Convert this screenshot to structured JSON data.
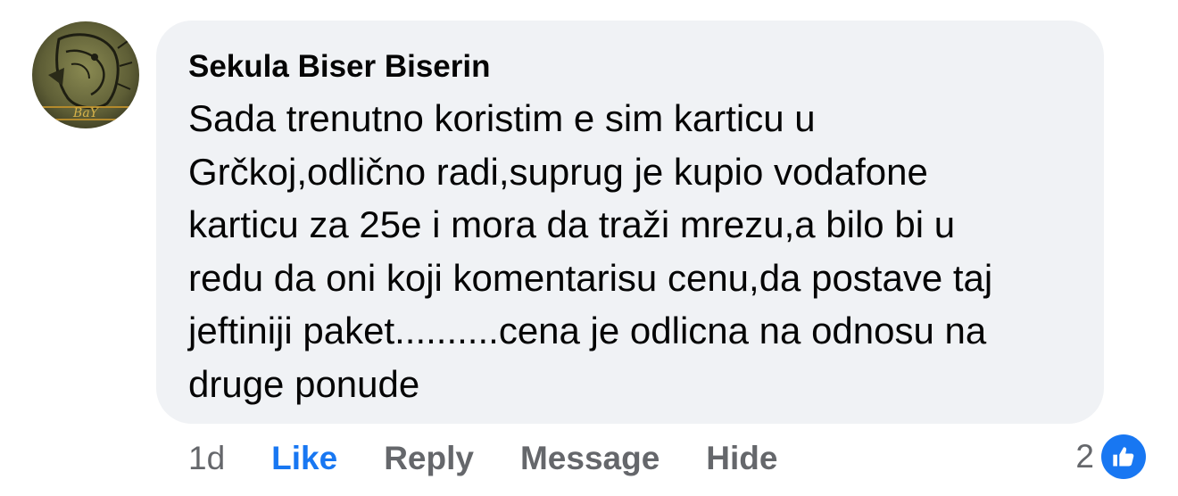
{
  "comment": {
    "author": "Sekula Biser Biserin",
    "text_lines": [
      "Sada trenutno koristim e sim karticu u",
      "Grčkoj,odlično radi,suprug je kupio vodafone",
      "karticu za 25e i mora da traži mrezu,a bilo bi u",
      "redu da oni koji komentarisu cenu,da postave taj",
      "jeftiniji paket..........cena je odlicna na odnosu na",
      "druge ponude"
    ],
    "avatar_monogram": "BaY"
  },
  "actions": {
    "time": "1d",
    "like_label": "Like",
    "reply_label": "Reply",
    "message_label": "Message",
    "hide_label": "Hide"
  },
  "reactions": {
    "count": "2",
    "icon": "thumbs-up-icon"
  },
  "colors": {
    "bubble": "#f0f2f5",
    "like_blue": "#1877f2",
    "secondary_text": "#65676b",
    "primary_text": "#050505"
  }
}
